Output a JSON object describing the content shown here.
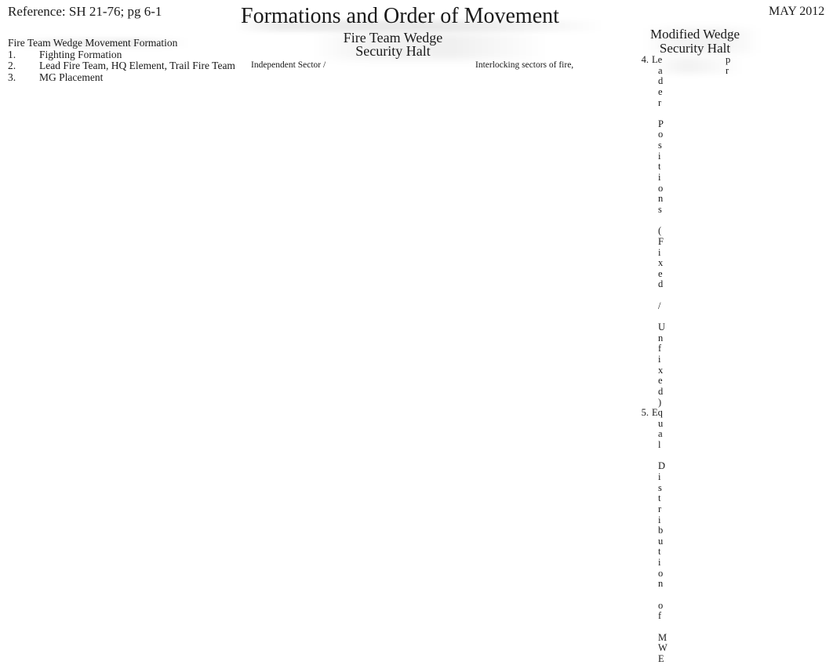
{
  "header": {
    "reference": "Reference: SH 21-76; pg 6-1",
    "date": "MAY 2012",
    "title": "Formations and Order of Movement"
  },
  "center_heading": {
    "line1": "Fire Team Wedge",
    "line2": "Security Halt"
  },
  "right_heading": {
    "line1": "Modified Wedge",
    "line2": "Security Halt"
  },
  "left_list": {
    "title": "Fire Team Wedge Movement Formation",
    "items": [
      {
        "num": "1.",
        "label": "Fighting Formation"
      },
      {
        "num": "2.",
        "label": "Lead Fire Team, HQ Element, Trail Fire Team"
      },
      {
        "num": "3.",
        "label": "MG Placement"
      }
    ]
  },
  "annotations": {
    "independent_sector": "Independent Sector /",
    "interlocking_sectors": "Interlocking sectors of fire,"
  },
  "wrapped_list": {
    "items": [
      {
        "num": "4.",
        "label": "Leader Positions (Fixed / Unfixed)",
        "head": "Le",
        "tail_chars": [
          "a",
          "d",
          "e",
          "r",
          " ",
          "P",
          "o",
          "s",
          "i",
          "t",
          "i",
          "o",
          "n",
          "s",
          " ",
          "(",
          "F",
          "i",
          "x",
          "e",
          "d",
          " ",
          "/",
          " ",
          "U",
          "n",
          "f",
          "i",
          "x",
          "e",
          "d",
          ")"
        ]
      },
      {
        "num": "5.",
        "label": "Equal Distribution of MWE",
        "head": "Eq",
        "tail_chars": [
          "u",
          "a",
          "l",
          " ",
          "D",
          "i",
          "s",
          "t",
          "r",
          "i",
          "b",
          "u",
          "t",
          "i",
          "o",
          "n",
          " ",
          "o",
          "f",
          " ",
          "M",
          "W",
          "E"
        ]
      }
    ]
  },
  "orphan_chars": [
    "p",
    "r"
  ],
  "colors": {
    "text": "#1a1a1a",
    "background": "#ffffff",
    "smudge": "rgba(0,0,0,0.06)"
  }
}
